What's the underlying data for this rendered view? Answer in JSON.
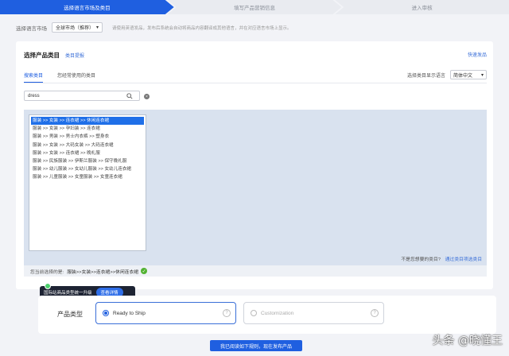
{
  "steps": [
    "选择语言市场及类目",
    "填写产品营销信息",
    "进入审核"
  ],
  "market": {
    "label": "选择语言市场",
    "select_value": "全球市场（推荐）",
    "hint": "请使用英语发品，发布后系统会自动将商品内容翻译成其他语言，并在对应语言市场上显示。"
  },
  "category": {
    "title": "选择产品类目",
    "tip_link": "类目提报",
    "quick_link": "快速发品",
    "tabs": [
      "搜索类目",
      "您经常使用的类目"
    ],
    "active_tab": 0,
    "lang_label": "选择类目显示语言",
    "lang_value": "简体中文",
    "search_value": "dress",
    "results": [
      "服装 >> 女装 >> 连衣裙 >> 休闲连衣裙",
      "服装 >> 女装 >> 孕妇装 >> 连衣裙",
      "服装 >> 男装 >> 男士内衣裤 >> 塑身衣",
      "服装 >> 女装 >> 大码女装 >> 大码连衣裙",
      "服装 >> 女装 >> 连衣裙 >> 晚礼服",
      "服装 >> 民族服装 >> 伊斯兰服装 >> 保守晚礼服",
      "服装 >> 幼儿服装 >> 女幼儿服装 >> 女幼儿连衣裙",
      "服装 >> 儿童服装 >> 女童服装 >> 女童连衣裙"
    ],
    "selected_index": 0,
    "not_found_text": "不是您想要的类目?",
    "not_found_link": "通过类目项选类目",
    "selected_label": "您当前选择的是:",
    "selected_path": "服装>>女装>>连衣裙>>休闲连衣裙"
  },
  "tooltip": {
    "text": "国际站商品类型统一升级",
    "button": "查看详情"
  },
  "product_type": {
    "label": "产品类型",
    "options": [
      "Ready to Ship",
      "Customization"
    ],
    "selected": 0
  },
  "submit_label": "我已阅读如下规则，现在发布产品",
  "watermark": "头条 @晓懂王",
  "colors": {
    "primary": "#1f5fe0",
    "result_bg": "#d9e2ef",
    "check": "#52b232"
  }
}
